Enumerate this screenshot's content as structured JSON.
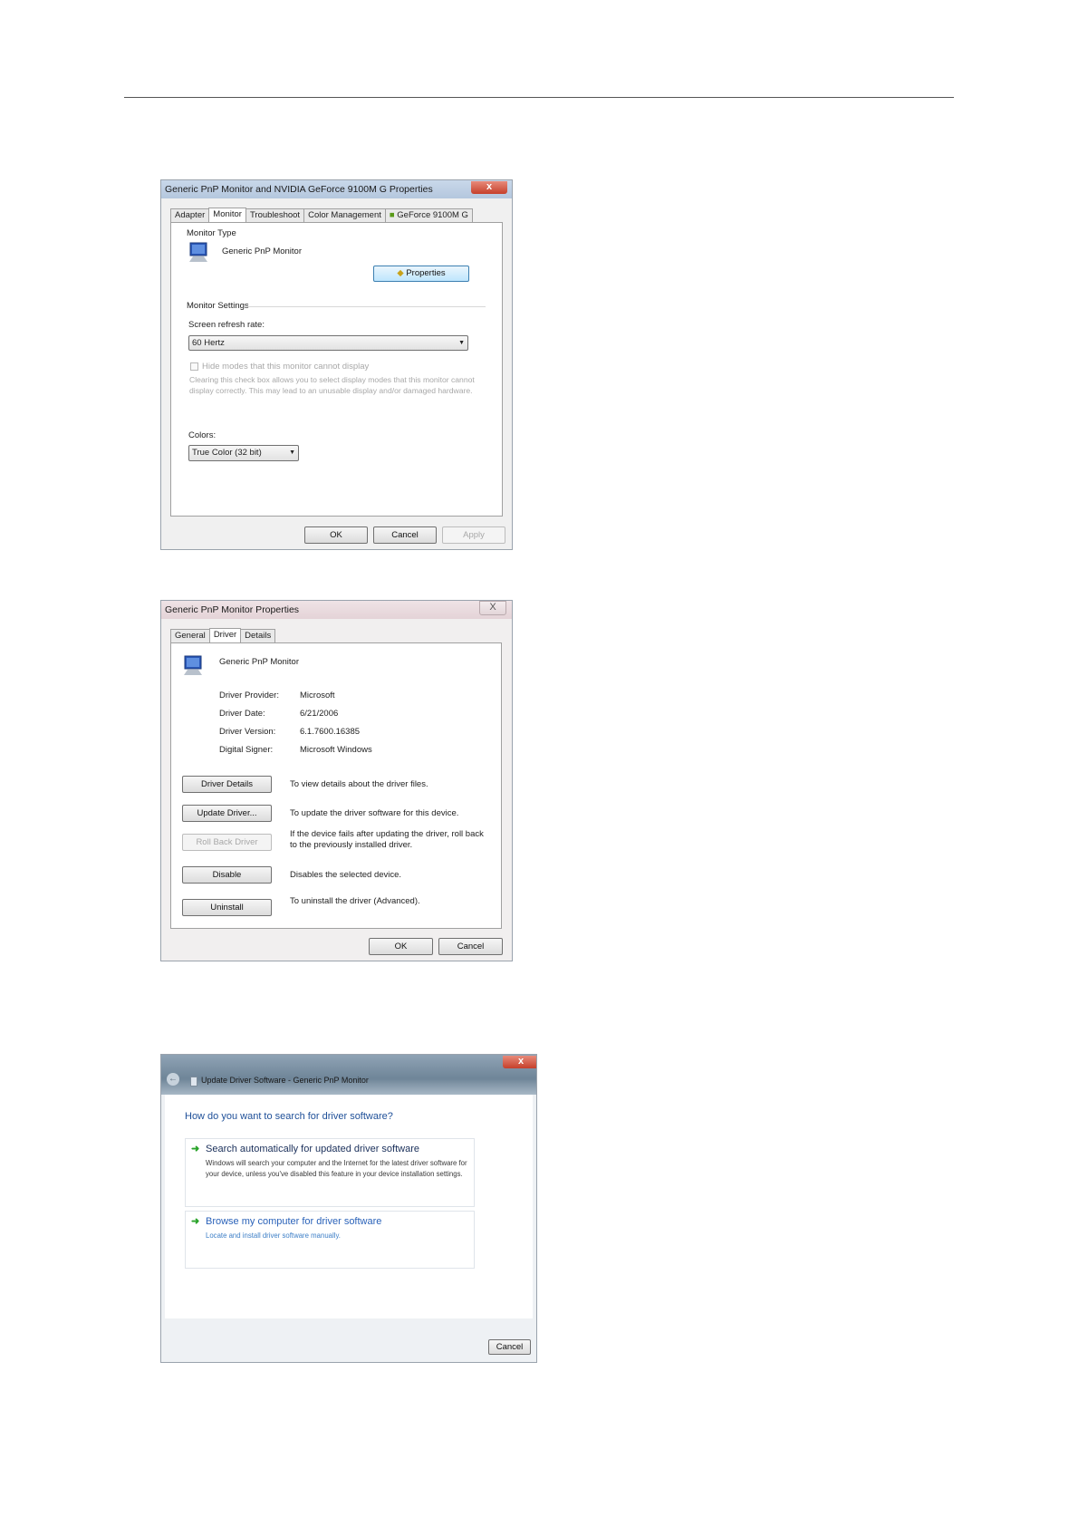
{
  "monitor_props": {
    "title": "Generic PnP Monitor and NVIDIA GeForce 9100M G   Properties",
    "close_glyph": "x",
    "tabs": [
      "Adapter",
      "Monitor",
      "Troubleshoot",
      "Color Management",
      "GeForce 9100M G"
    ],
    "active_tab": "Monitor",
    "monitor_type_label": "Monitor Type",
    "monitor_name": "Generic PnP Monitor",
    "properties_button": "Properties",
    "monitor_settings_label": "Monitor Settings",
    "refresh_rate_label": "Screen refresh rate:",
    "refresh_rate_value": "60 Hertz",
    "hide_modes_label": "Hide modes that this monitor cannot display",
    "hide_modes_desc": "Clearing this check box allows you to select display modes that this monitor cannot display correctly. This may lead to an unusable display and/or damaged hardware.",
    "colors_label": "Colors:",
    "colors_value": "True Color (32 bit)",
    "ok": "OK",
    "cancel": "Cancel",
    "apply": "Apply"
  },
  "driver_props": {
    "title": "Generic PnP Monitor Properties",
    "close_glyph": "X",
    "tabs": [
      "General",
      "Driver",
      "Details"
    ],
    "active_tab": "Driver",
    "device_name": "Generic PnP Monitor",
    "info": [
      {
        "label": "Driver Provider:",
        "value": "Microsoft"
      },
      {
        "label": "Driver Date:",
        "value": "6/21/2006"
      },
      {
        "label": "Driver Version:",
        "value": "6.1.7600.16385"
      },
      {
        "label": "Digital Signer:",
        "value": "Microsoft Windows"
      }
    ],
    "actions": [
      {
        "button": "Driver Details",
        "desc": "To view details about the driver files."
      },
      {
        "button": "Update Driver...",
        "desc": "To update the driver software for this device."
      },
      {
        "button": "Roll Back Driver",
        "desc": "If the device fails after updating the driver, roll back to the previously installed driver."
      },
      {
        "button": "Disable",
        "desc": "Disables the selected device."
      },
      {
        "button": "Uninstall",
        "desc": "To uninstall the driver (Advanced)."
      }
    ],
    "ok": "OK",
    "cancel": "Cancel"
  },
  "update_wizard": {
    "title": "Update Driver Software - Generic PnP Monitor",
    "close_glyph": "x",
    "question": "How do you want to search for driver software?",
    "option1_title": "Search automatically for updated driver software",
    "option1_desc": "Windows will search your computer and the Internet for the latest driver software for your device, unless you've disabled this feature in your device installation settings.",
    "option2_title": "Browse my computer for driver software",
    "option2_desc": "Locate and install driver software manually.",
    "cancel": "Cancel"
  },
  "colors": {
    "link_blue": "#2a62b9",
    "heading_blue": "#1e4f98",
    "close_red": "#c6402b",
    "arrow_green": "#2aa32a"
  }
}
